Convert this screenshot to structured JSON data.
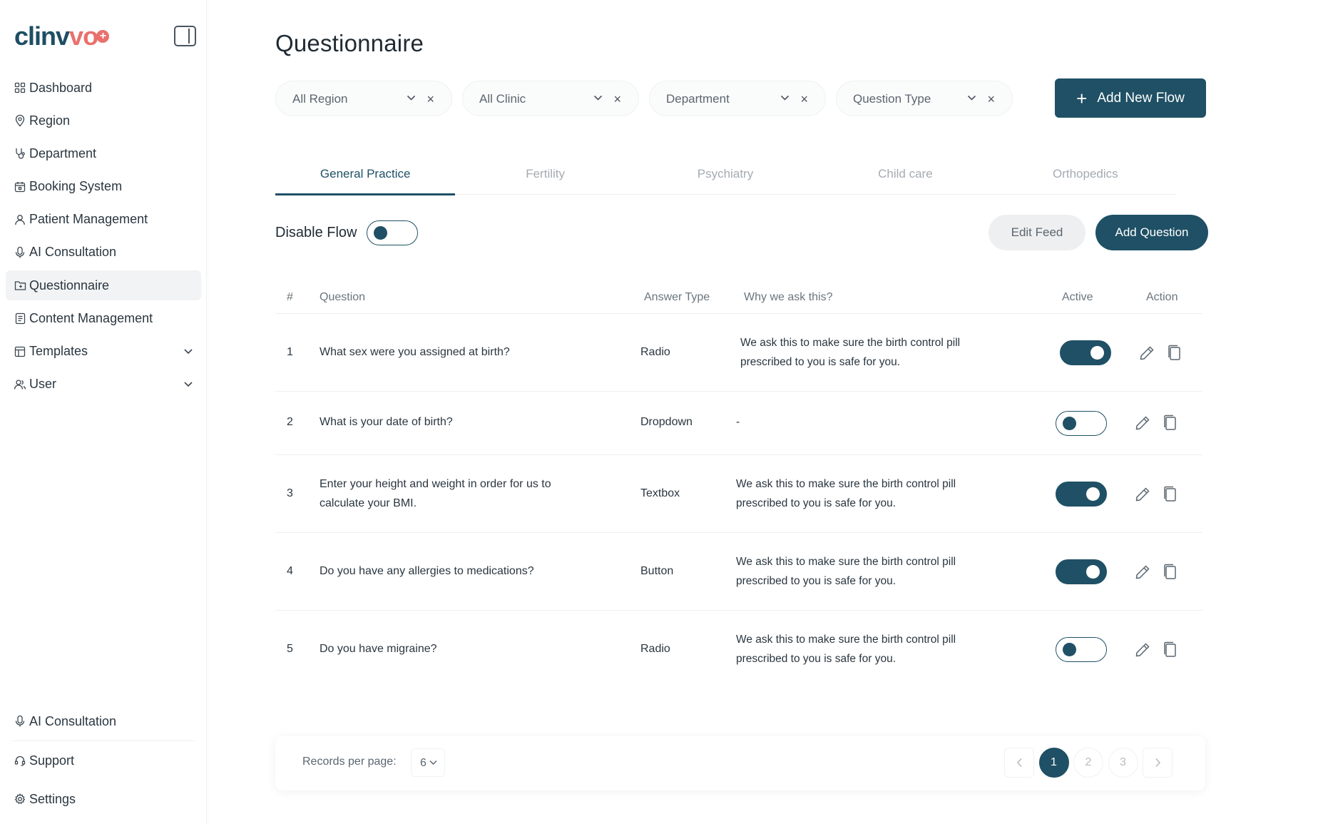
{
  "brand": {
    "name_main": "clinv",
    "name_accent": "vo"
  },
  "sidebar": {
    "items": [
      {
        "label": "Dashboard",
        "icon": "dashboard-icon"
      },
      {
        "label": "Region",
        "icon": "location-pin-icon"
      },
      {
        "label": "Department",
        "icon": "stethoscope-icon"
      },
      {
        "label": "Booking System",
        "icon": "calendar-icon"
      },
      {
        "label": "Patient Management",
        "icon": "user-icon"
      },
      {
        "label": "AI Consultation",
        "icon": "microphone-icon"
      },
      {
        "label": "Questionnaire",
        "icon": "folder-icon",
        "active": true
      },
      {
        "label": "Content Management",
        "icon": "document-icon"
      },
      {
        "label": "Templates",
        "icon": "template-icon",
        "expandable": true
      },
      {
        "label": "User",
        "icon": "users-icon",
        "expandable": true
      }
    ],
    "bottom": [
      {
        "label": "AI Consultation",
        "icon": "microphone-icon"
      },
      {
        "label": "Support",
        "icon": "headset-icon"
      },
      {
        "label": "Settings",
        "icon": "gear-icon"
      }
    ]
  },
  "page": {
    "title": "Questionnaire"
  },
  "filters": [
    {
      "label": "All Region"
    },
    {
      "label": "All Clinic"
    },
    {
      "label": "Department"
    },
    {
      "label": "Question Type"
    }
  ],
  "add_flow_label": "Add New Flow",
  "tabs": [
    {
      "label": "General Practice",
      "active": true
    },
    {
      "label": "Fertility"
    },
    {
      "label": "Psychiatry"
    },
    {
      "label": "Child care"
    },
    {
      "label": "Orthopedics"
    }
  ],
  "disable_flow": {
    "label": "Disable Flow",
    "on": false
  },
  "edit_feed_label": "Edit Feed",
  "add_question_label": "Add Question",
  "table": {
    "headers": {
      "num": "#",
      "question": "Question",
      "answer_type": "Answer Type",
      "why": "Why we ask this?",
      "active": "Active",
      "action": "Action"
    },
    "rows": [
      {
        "num": "1",
        "question_line1": "What sex were you assigned at birth?",
        "question_line2": "",
        "answer_type": "Radio",
        "why_line1": "We ask this to make sure the birth control pill",
        "why_line2": "prescribed to you is safe for you.",
        "active": true
      },
      {
        "num": "2",
        "question_line1": "What is your date of birth?",
        "question_line2": "",
        "answer_type": "Dropdown",
        "why_line1": "-",
        "why_line2": "",
        "active": false
      },
      {
        "num": "3",
        "question_line1": "Enter your height and weight in order for us to",
        "question_line2": "calculate your BMI.",
        "answer_type": "Textbox",
        "why_line1": "We ask this to make sure the birth control pill",
        "why_line2": "prescribed to you is safe for you.",
        "active": true
      },
      {
        "num": "4",
        "question_line1": "Do you have any allergies to medications?",
        "question_line2": "",
        "answer_type": "Button",
        "why_line1": "We ask this to make sure the birth control pill",
        "why_line2": "prescribed to you is safe for you.",
        "active": true
      },
      {
        "num": "5",
        "question_line1": "Do you have migraine?",
        "question_line2": "",
        "answer_type": "Radio",
        "why_line1": "We ask this to make sure the birth control pill",
        "why_line2": "prescribed to you is safe for you.",
        "active": false
      }
    ]
  },
  "pagination": {
    "records_label": "Records per page:",
    "records_value": "6",
    "pages": [
      "1",
      "2",
      "3"
    ],
    "current": "1"
  },
  "colors": {
    "primary": "#1f5065",
    "brand_accent": "#e8716d",
    "muted_text": "#a4abb1"
  }
}
